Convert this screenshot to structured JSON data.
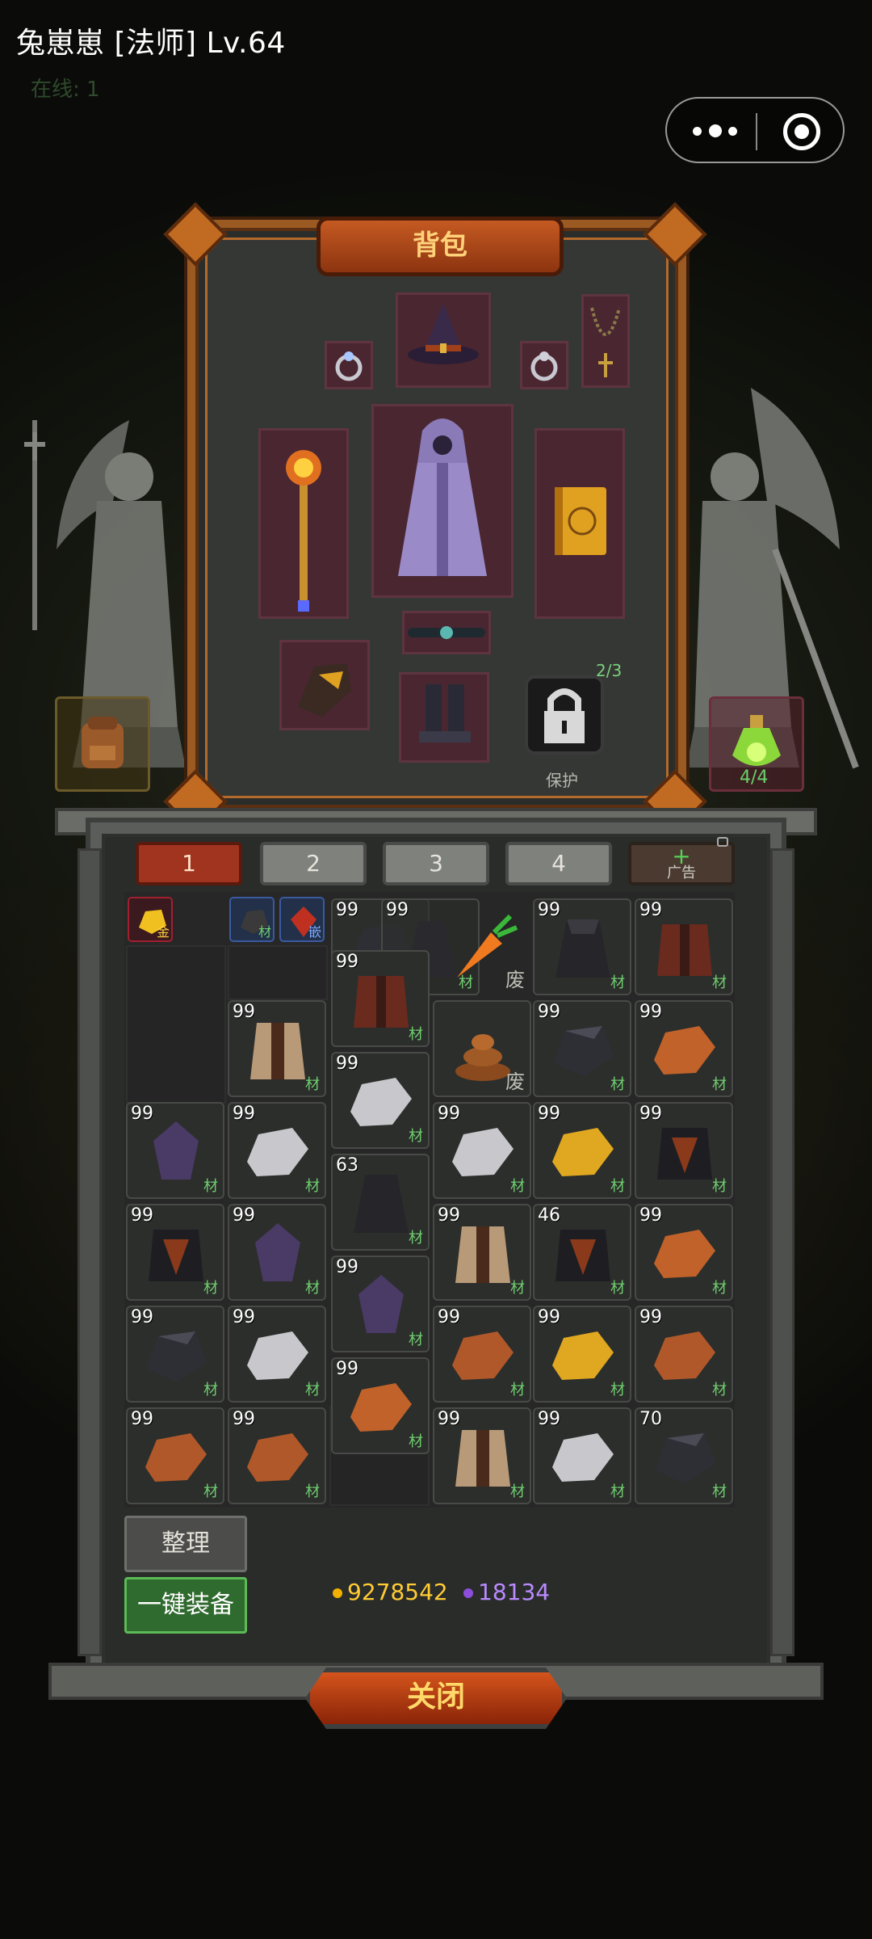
{
  "header": {
    "title": "兔崽崽 [法师] Lv.64",
    "online": "在线: 1"
  },
  "equipment": {
    "title": "背包",
    "lock_count": "2/3",
    "lock_label": "保护",
    "side_right_count": "4/4"
  },
  "tabs": [
    {
      "label": "1",
      "active": true
    },
    {
      "label": "2",
      "active": false
    },
    {
      "label": "3",
      "active": false
    },
    {
      "label": "4",
      "active": false
    }
  ],
  "ad_tab": {
    "plus": "+",
    "label": "广告"
  },
  "tags": {
    "material": "材",
    "embed": "嵌",
    "gold": "金",
    "waste": "废"
  },
  "inventory": {
    "row0": [
      {
        "count": "99",
        "tag": "材",
        "item": "dark-coal"
      },
      {
        "count": "99",
        "tag": "材",
        "item": "dark-cloak"
      },
      {
        "count": "",
        "tag": "废",
        "item": "carrot"
      },
      {
        "count": "99",
        "tag": "材",
        "item": "dark-cloak"
      },
      {
        "count": "99",
        "tag": "材",
        "item": "red-armor"
      }
    ],
    "row1": [
      {
        "count": "99",
        "tag": "材",
        "item": "fur-vest"
      },
      {
        "count": "99",
        "tag": "材",
        "item": "red-armor"
      },
      {
        "count": "",
        "tag": "废",
        "item": "poop"
      },
      {
        "count": "99",
        "tag": "材",
        "item": "coal"
      },
      {
        "count": "99",
        "tag": "材",
        "item": "copper-ore"
      }
    ],
    "row2": [
      {
        "count": "99",
        "tag": "材",
        "item": "purple-crystal"
      },
      {
        "count": "99",
        "tag": "材",
        "item": "silver-ore"
      },
      {
        "count": "99",
        "tag": "材",
        "item": "silver-ore"
      },
      {
        "count": "99",
        "tag": "材",
        "item": "silver-ore"
      },
      {
        "count": "99",
        "tag": "材",
        "item": "gold-ore"
      },
      {
        "count": "99",
        "tag": "材",
        "item": "black-armor"
      }
    ],
    "row3": [
      {
        "count": "99",
        "tag": "材",
        "item": "black-armor"
      },
      {
        "count": "99",
        "tag": "材",
        "item": "purple-crystal"
      },
      {
        "count": "63",
        "tag": "材",
        "item": "dark-cloak"
      },
      {
        "count": "99",
        "tag": "材",
        "item": "fur-vest"
      },
      {
        "count": "46",
        "tag": "材",
        "item": "black-armor"
      },
      {
        "count": "99",
        "tag": "材",
        "item": "copper-ore"
      }
    ],
    "row4": [
      {
        "count": "99",
        "tag": "材",
        "item": "coal"
      },
      {
        "count": "99",
        "tag": "材",
        "item": "silver-ore"
      },
      {
        "count": "99",
        "tag": "材",
        "item": "purple-crystal"
      },
      {
        "count": "99",
        "tag": "材",
        "item": "copper-ore"
      },
      {
        "count": "99",
        "tag": "材",
        "item": "gold-ore"
      },
      {
        "count": "99",
        "tag": "材",
        "item": "copper-ore"
      }
    ],
    "row5": [
      {
        "count": "99",
        "tag": "材",
        "item": "copper-ore"
      },
      {
        "count": "99",
        "tag": "材",
        "item": "copper-ore"
      },
      {
        "count": "99",
        "tag": "材",
        "item": "copper-ore"
      },
      {
        "count": "99",
        "tag": "材",
        "item": "fur-vest"
      },
      {
        "count": "99",
        "tag": "材",
        "item": "silver-ore"
      },
      {
        "count": "70",
        "tag": "材",
        "item": "coal"
      }
    ]
  },
  "buttons": {
    "sort": "整理",
    "auto_equip": "一键装备",
    "close": "关闭"
  },
  "currency": {
    "gold": "9278542",
    "gem": "18134"
  },
  "colors": {
    "accent_orange": "#c55a22",
    "gold_text": "#ffcc33",
    "gem_text": "#b98bff",
    "material_tag": "#6fcf6f"
  }
}
